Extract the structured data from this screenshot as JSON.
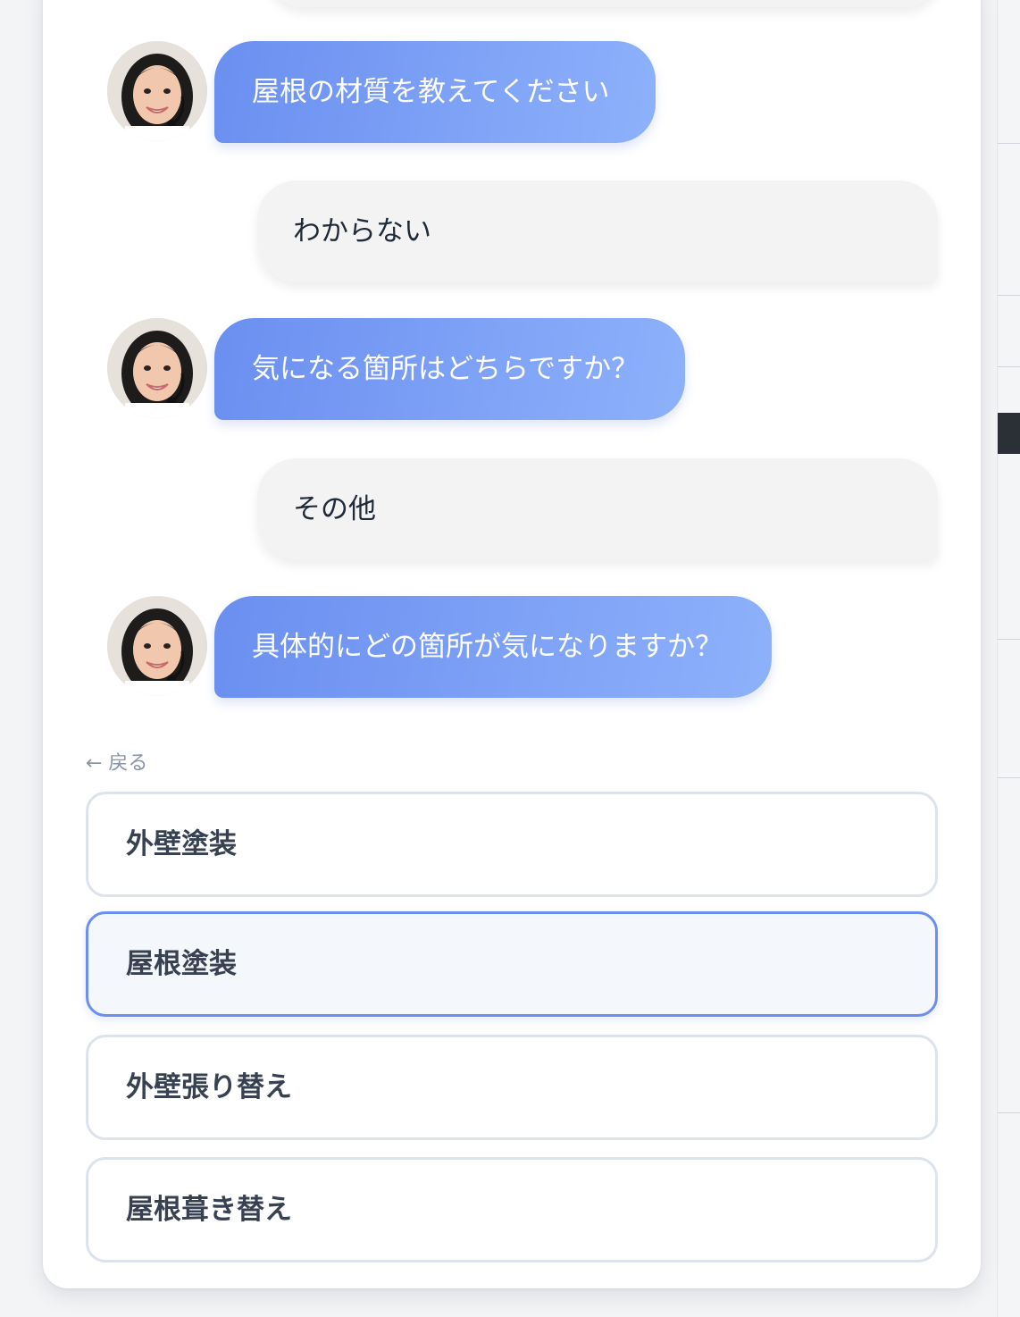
{
  "chat": {
    "messages": [
      {
        "role": "bot",
        "text": "屋根の材質を教えてください"
      },
      {
        "role": "user",
        "text": "わからない"
      },
      {
        "role": "bot",
        "text": "気になる箇所はどちらですか？"
      },
      {
        "role": "user",
        "text": "その他"
      },
      {
        "role": "bot",
        "text": "具体的にどの箇所が気になりますか？"
      }
    ],
    "avatar_icon": "operator-avatar-icon"
  },
  "back": {
    "label": "← 戻る"
  },
  "options": [
    {
      "label": "外壁塗装",
      "selected": false
    },
    {
      "label": "屋根塗装",
      "selected": true
    },
    {
      "label": "外壁張り替え",
      "selected": false
    },
    {
      "label": "屋根葺き替え",
      "selected": false
    }
  ],
  "colors": {
    "bot_bubble_start": "#6a8ff0",
    "bot_bubble_end": "#8eb1fb",
    "user_bubble": "#f3f3f4",
    "selected_border": "#6a8ff0"
  }
}
